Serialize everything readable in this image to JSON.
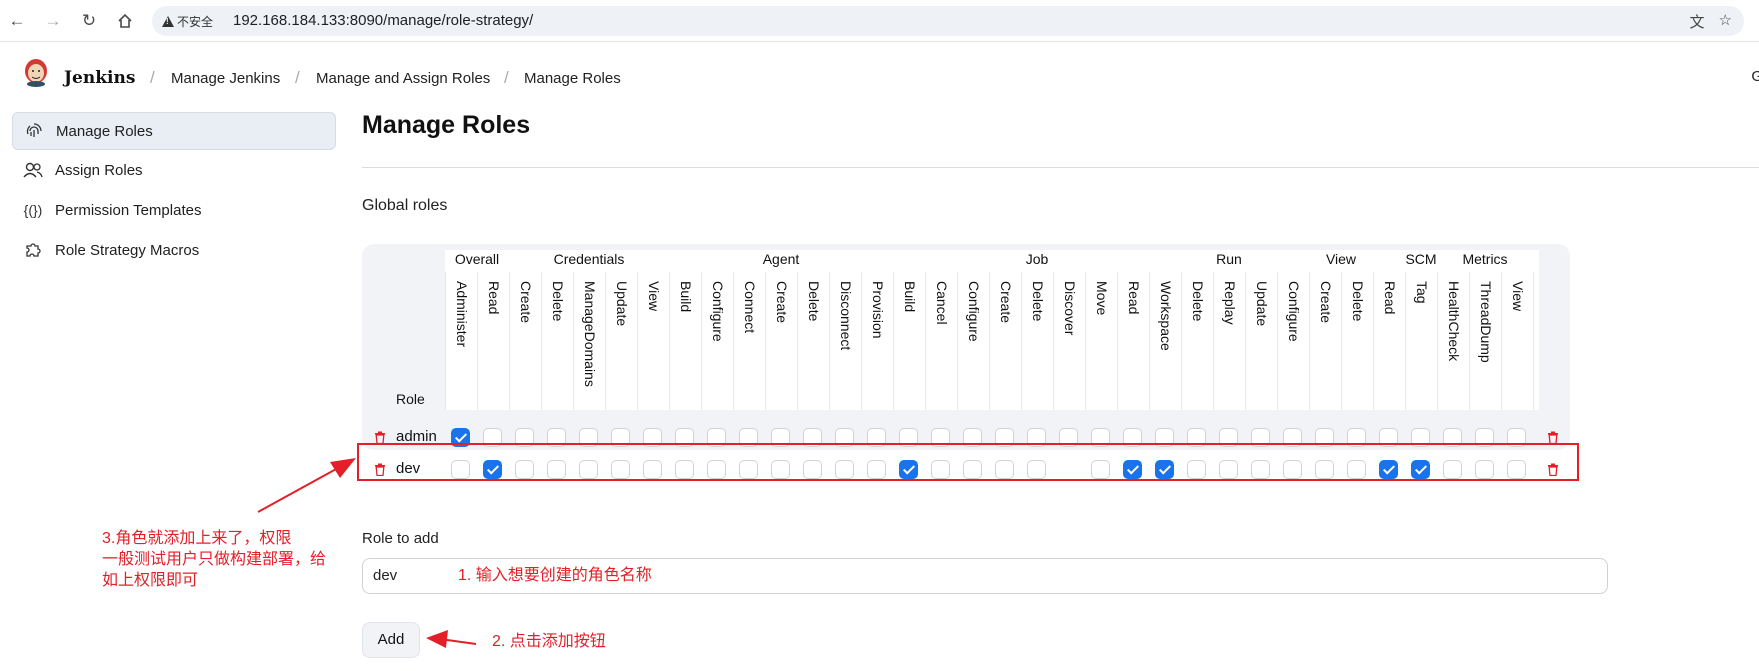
{
  "browser": {
    "security_label": "不安全",
    "url": "192.168.184.133:8090/manage/role-strategy/"
  },
  "header": {
    "brand": "Jenkins",
    "breadcrumbs": [
      "Manage Jenkins",
      "Manage and Assign Roles",
      "Manage Roles"
    ],
    "right_partial": "G"
  },
  "sidebar": {
    "items": [
      {
        "label": "Manage Roles",
        "icon": "fingerprint-icon",
        "active": true
      },
      {
        "label": "Assign Roles",
        "icon": "users-icon",
        "active": false
      },
      {
        "label": "Permission Templates",
        "icon": "braces-icon",
        "active": false
      },
      {
        "label": "Role Strategy Macros",
        "icon": "puzzle-icon",
        "active": false
      }
    ]
  },
  "main": {
    "title": "Manage Roles",
    "section_title": "Global roles",
    "role_header": "Role",
    "groups": [
      {
        "name": "Overall",
        "span": 2
      },
      {
        "name": "Credentials",
        "span": 5
      },
      {
        "name": "Agent",
        "span": 7
      },
      {
        "name": "Job",
        "span": 9
      },
      {
        "name": "Run",
        "span": 3
      },
      {
        "name": "View",
        "span": 4
      },
      {
        "name": "SCM",
        "span": 1
      },
      {
        "name": "Metrics",
        "span": 3
      }
    ],
    "permissions": [
      "Administer",
      "Read",
      "Create",
      "Delete",
      "ManageDomains",
      "Update",
      "View",
      "Build",
      "Configure",
      "Connect",
      "Create",
      "Delete",
      "Disconnect",
      "Provision",
      "Build",
      "Cancel",
      "Configure",
      "Create",
      "Delete",
      "Discover",
      "Move",
      "Read",
      "Workspace",
      "Delete",
      "Replay",
      "Update",
      "Configure",
      "Create",
      "Delete",
      "Read",
      "Tag",
      "HealthCheck",
      "ThreadDump",
      "View"
    ],
    "roles": [
      {
        "name": "admin",
        "checked": [
          0
        ]
      },
      {
        "name": "dev",
        "checked": [
          1,
          14,
          21,
          22,
          29,
          30
        ],
        "hidden": [
          19
        ]
      }
    ],
    "role_to_add_label": "Role to add",
    "role_to_add_value": "dev",
    "add_button": "Add"
  },
  "annotations": {
    "input_note": "1. 输入想要创建的角色名称",
    "button_note": "2. 点击添加按钮",
    "result_note_lines": [
      "3.角色就添加上来了，权限",
      "一般测试用户只做构建部署，给",
      "如上权限即可"
    ]
  },
  "colors": {
    "accent": "#1a73e8",
    "annotation": "#e3202a",
    "delete": "#e3202a"
  }
}
